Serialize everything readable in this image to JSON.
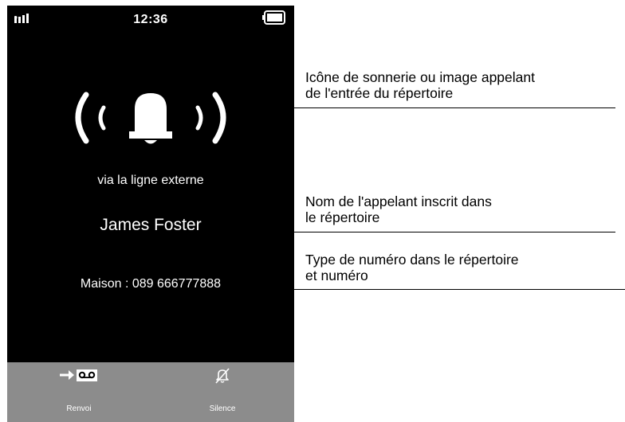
{
  "phone": {
    "time": "12:36",
    "line_label": "via la ligne externe",
    "caller_name": "James Foster",
    "caller_number": "Maison : 089 666777888",
    "actions": [
      {
        "label": "Renvoi",
        "icon": "forward-to-voicemail-icon"
      },
      {
        "label": "Silence",
        "icon": "bell-muted-icon"
      }
    ],
    "colors": {
      "screen": "#000000",
      "text": "#ffffff",
      "action_bar": "#8c8c8c"
    }
  },
  "annotations": [
    {
      "line1": "Icône de sonnerie ou image appelant",
      "line2": "de l'entrée du répertoire"
    },
    {
      "line1": "Nom de l'appelant inscrit dans",
      "line2": "le répertoire"
    },
    {
      "line1": "Type de numéro dans le répertoire",
      "line2": "et numéro"
    }
  ]
}
